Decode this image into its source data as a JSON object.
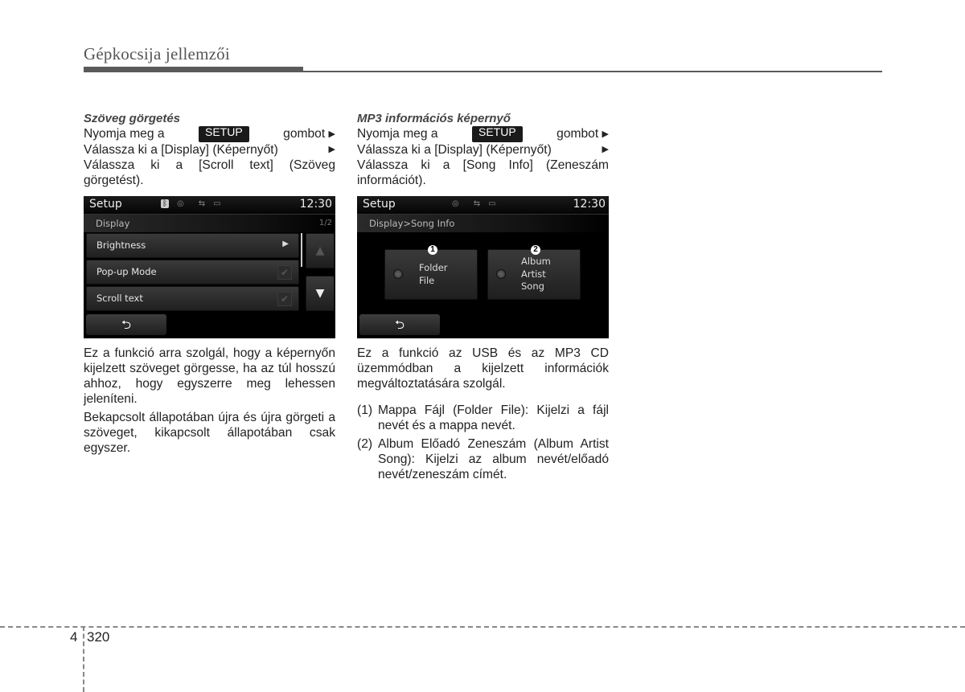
{
  "header": {
    "title": "Gépkocsija jellemzői"
  },
  "left": {
    "section_title": "Szöveg görgetés",
    "step1_prefix": "Nyomja meg a",
    "setup_badge": "SETUP",
    "step1_suffix": "gombot",
    "step2": "Válassza ki a [Display] (Képernyőt)",
    "step3": "Válassza ki a [Scroll text] (Szöveg görgetést).",
    "screen": {
      "title": "Setup",
      "clock": "12:30",
      "icons": [
        "bluetooth-icon",
        "disc-icon",
        "usb-icon",
        "battery-icon"
      ],
      "subheader": "Display",
      "page": "1/2",
      "items": [
        {
          "label": "Brightness",
          "control": "arrow"
        },
        {
          "label": "Pop-up Mode",
          "control": "check"
        },
        {
          "label": "Scroll text",
          "control": "check"
        }
      ],
      "back_symbol": "⮌"
    },
    "desc1": "Ez a funkció arra szolgál, hogy a képernyőn kijelzett szöveget görgesse, ha az túl hosszú ahhoz, hogy egyszerre meg lehessen jeleníteni.",
    "desc2": "Bekapcsolt állapotában újra és újra görgeti a szöveget, kikapcsolt állapotában csak egyszer."
  },
  "right": {
    "section_title": "MP3 információs képernyő",
    "step1_prefix": "Nyomja meg a",
    "setup_badge": "SETUP",
    "step1_suffix": "gombot",
    "step2": "Válassza ki a [Display] (Képernyőt)",
    "step3": "Válassza ki a [Song Info] (Zeneszám információt).",
    "screen": {
      "title": "Setup",
      "clock": "12:30",
      "icons": [
        "disc-icon",
        "usb-icon",
        "battery-icon"
      ],
      "subheader": "Display>Song Info",
      "options": [
        {
          "callout": "1",
          "line1": "Folder",
          "line2": "File",
          "line3": ""
        },
        {
          "callout": "2",
          "line1": "Album",
          "line2": "Artist",
          "line3": "Song"
        }
      ]
    },
    "desc1": "Ez a funkció az USB és az MP3 CD üzemmódban a kijelzett információk megváltoztatására szolgál.",
    "list": [
      {
        "num": "(1)",
        "text": "Mappa Fájl (Folder File): Kijelzi a fájl nevét és a mappa nevét."
      },
      {
        "num": "(2)",
        "text": "Album Előadó Zeneszám (Album Artist Song): Kijelzi az album nevét/előadó nevét/zeneszám címét."
      }
    ]
  },
  "footer": {
    "chapter": "4",
    "page": "320"
  }
}
